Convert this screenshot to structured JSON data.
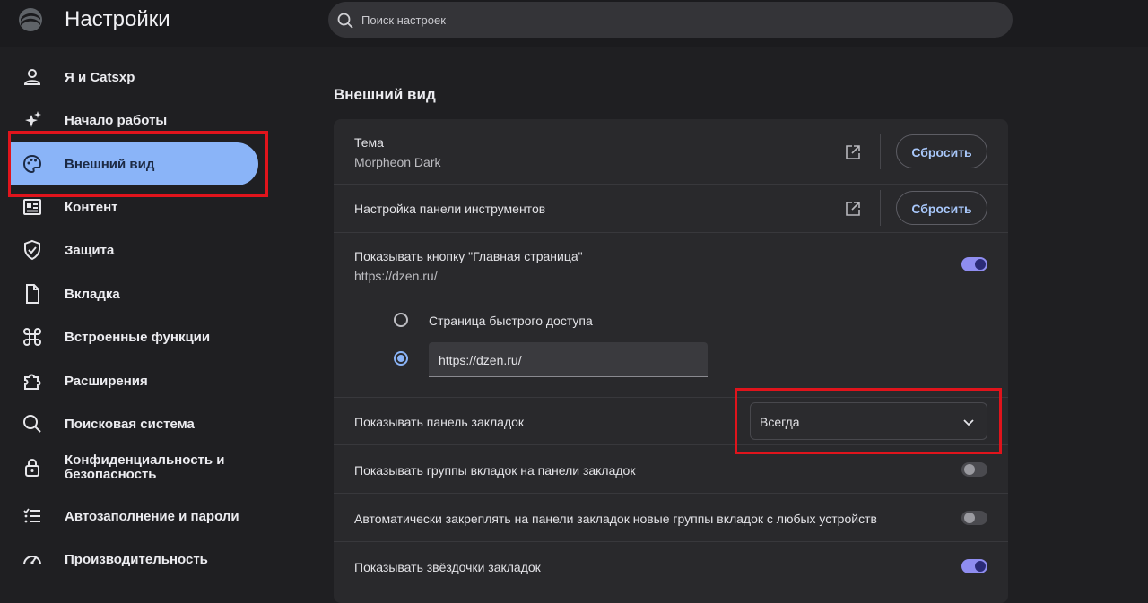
{
  "header": {
    "title": "Настройки",
    "search_placeholder": "Поиск настроек",
    "logo_icon": "opera-gx-logo-icon",
    "search_icon": "search-icon"
  },
  "sidebar": {
    "active_color": "#8ab4f8",
    "items": [
      {
        "label": "Я и Catsxp",
        "icon": "person-icon"
      },
      {
        "label": "Начало работы",
        "icon": "sparkle-star-icon"
      },
      {
        "label": "Внешний вид",
        "icon": "palette-icon",
        "active": true
      },
      {
        "label": "Контент",
        "icon": "newspaper-icon"
      },
      {
        "label": "Защита",
        "icon": "shield-check-icon"
      },
      {
        "label": "Вкладка",
        "icon": "document-icon"
      },
      {
        "label": "Встроенные функции",
        "icon": "command-icon"
      },
      {
        "label": "Расширения",
        "icon": "puzzle-icon"
      },
      {
        "label": "Поисковая система",
        "icon": "search-icon"
      },
      {
        "label": "Конфиденциальность и безопасность",
        "icon": "lock-icon"
      },
      {
        "label": "Автозаполнение и пароли",
        "icon": "checklist-icon"
      },
      {
        "label": "Производительность",
        "icon": "speedometer-icon"
      }
    ]
  },
  "main": {
    "section_title": "Внешний вид",
    "theme": {
      "label": "Тема",
      "value": "Morpheon Dark",
      "reset_label": "Сбросить",
      "icon": "external-link-icon"
    },
    "toolbar": {
      "label": "Настройка панели инструментов",
      "reset_label": "Сбросить",
      "icon": "external-link-icon"
    },
    "home_button": {
      "label": "Показывать кнопку \"Главная страница\"",
      "value": "https://dzen.ru/",
      "enabled": true,
      "option_quick_access": "Страница быстрого доступа",
      "custom_url": "https://dzen.ru/",
      "selected_option": "custom_url"
    },
    "bookmarks_bar": {
      "label": "Показывать панель закладок",
      "value": "Всегда",
      "icon": "chevron-down-icon"
    },
    "tab_groups": {
      "label": "Показывать группы вкладок на панели закладок",
      "enabled": false
    },
    "auto_pin": {
      "label": "Автоматически закреплять на панели закладок новые группы вкладок с любых устройств",
      "enabled": false
    },
    "stars": {
      "label": "Показывать звёздочки закладок",
      "enabled": true
    }
  },
  "colors": {
    "accent_toggle": "#8f8df0",
    "highlight_box": "#e0141c",
    "button_text": "#a8c7fa"
  }
}
